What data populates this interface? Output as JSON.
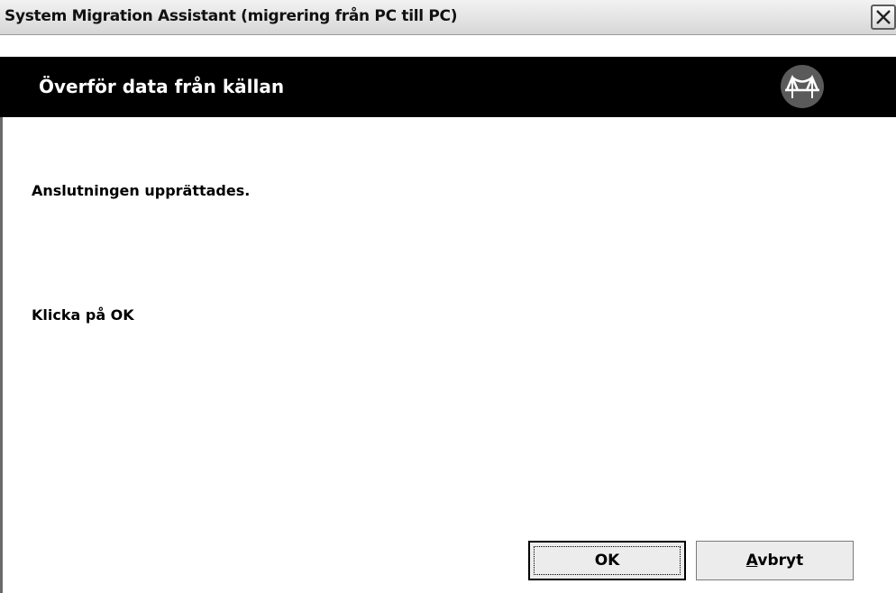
{
  "window": {
    "title": "System Migration Assistant (migrering från PC till PC)"
  },
  "header": {
    "title": "Överför data från källan",
    "logo_icon": "bridge-logo-icon"
  },
  "content": {
    "message_connection": "Anslutningen upprättades.",
    "message_instruction": "Klicka på OK"
  },
  "buttons": {
    "ok_label": "OK",
    "cancel_accel": "A",
    "cancel_rest": "vbryt"
  },
  "colors": {
    "header_bg": "#000000",
    "header_text": "#ffffff",
    "body_bg": "#ffffff"
  }
}
